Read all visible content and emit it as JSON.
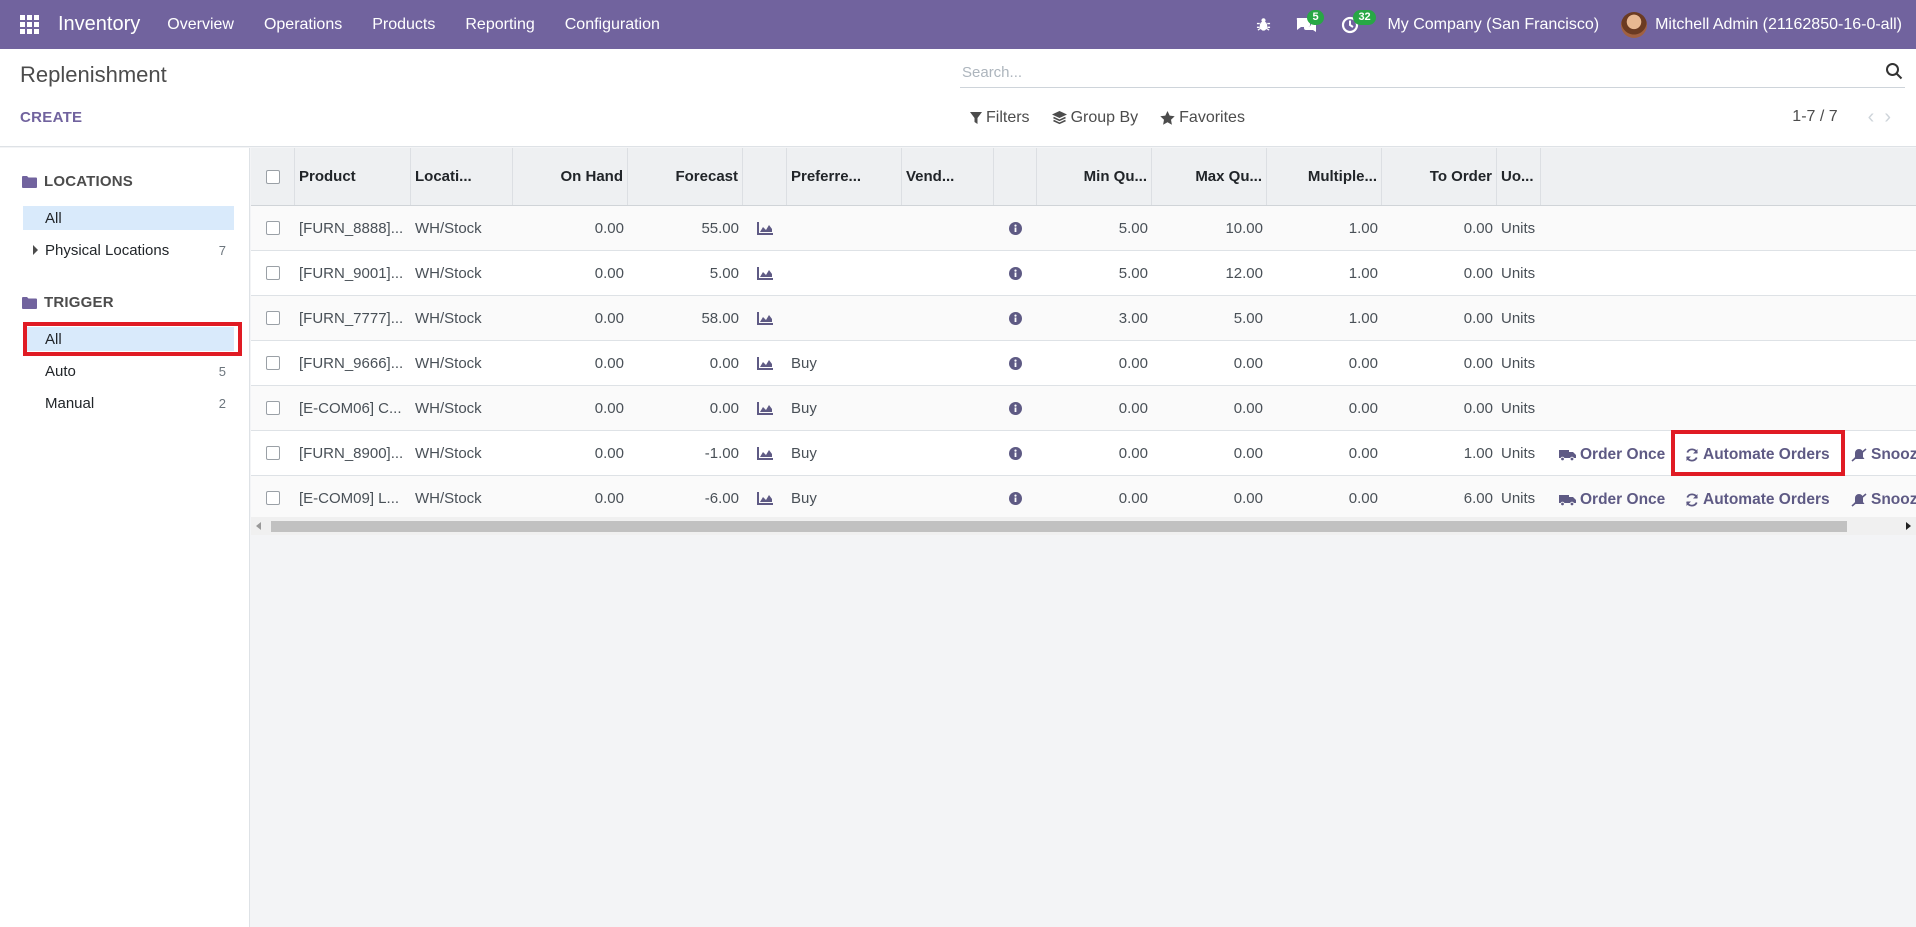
{
  "navbar": {
    "app_name": "Inventory",
    "menu": [
      "Overview",
      "Operations",
      "Products",
      "Reporting",
      "Configuration"
    ],
    "messages_badge": "5",
    "activities_badge": "32",
    "company": "My Company (San Francisco)",
    "user": "Mitchell Admin (21162850-16-0-all)",
    "bg_color": "#71639e"
  },
  "control_panel": {
    "title": "Replenishment",
    "create_label": "CREATE",
    "search_placeholder": "Search...",
    "filters_label": "Filters",
    "group_by_label": "Group By",
    "favorites_label": "Favorites",
    "pager": "1-7 / 7"
  },
  "search_panel": {
    "locations_header": "LOCATIONS",
    "locations_all": "All",
    "physical_locations": "Physical Locations",
    "physical_locations_count": "7",
    "trigger_header": "TRIGGER",
    "trigger_all": "All",
    "trigger_auto": "Auto",
    "trigger_auto_count": "5",
    "trigger_manual": "Manual",
    "trigger_manual_count": "2"
  },
  "table": {
    "headers": {
      "product": "Product",
      "location": "Locati...",
      "on_hand": "On Hand",
      "forecast": "Forecast",
      "preferred_route": "Preferre...",
      "vendor": "Vend...",
      "min_qty": "Min Qu...",
      "max_qty": "Max Qu...",
      "multiple": "Multiple...",
      "to_order": "To Order",
      "uom": "Uo..."
    },
    "rows": [
      {
        "product": "[FURN_8888]...",
        "location": "WH/Stock",
        "on_hand": "0.00",
        "forecast": "55.00",
        "route": "",
        "min": "5.00",
        "max": "10.00",
        "multiple": "1.00",
        "to_order": "0.00",
        "uom": "Units",
        "order_once": "",
        "automate": "",
        "snooze": ""
      },
      {
        "product": "[FURN_9001]...",
        "location": "WH/Stock",
        "on_hand": "0.00",
        "forecast": "5.00",
        "route": "",
        "min": "5.00",
        "max": "12.00",
        "multiple": "1.00",
        "to_order": "0.00",
        "uom": "Units",
        "order_once": "",
        "automate": "",
        "snooze": ""
      },
      {
        "product": "[FURN_7777]...",
        "location": "WH/Stock",
        "on_hand": "0.00",
        "forecast": "58.00",
        "route": "",
        "min": "3.00",
        "max": "5.00",
        "multiple": "1.00",
        "to_order": "0.00",
        "uom": "Units",
        "order_once": "",
        "automate": "",
        "snooze": ""
      },
      {
        "product": "[FURN_9666]...",
        "location": "WH/Stock",
        "on_hand": "0.00",
        "forecast": "0.00",
        "route": "Buy",
        "min": "0.00",
        "max": "0.00",
        "multiple": "0.00",
        "to_order": "0.00",
        "uom": "Units",
        "order_once": "",
        "automate": "",
        "snooze": ""
      },
      {
        "product": "[E-COM06] C...",
        "location": "WH/Stock",
        "on_hand": "0.00",
        "forecast": "0.00",
        "route": "Buy",
        "min": "0.00",
        "max": "0.00",
        "multiple": "0.00",
        "to_order": "0.00",
        "uom": "Units",
        "order_once": "",
        "automate": "",
        "snooze": ""
      },
      {
        "product": "[FURN_8900]...",
        "location": "WH/Stock",
        "on_hand": "0.00",
        "forecast": "-1.00",
        "route": "Buy",
        "min": "0.00",
        "max": "0.00",
        "multiple": "0.00",
        "to_order": "1.00",
        "uom": "Units",
        "order_once": "Order Once",
        "automate": "Automate Orders",
        "snooze": "Snooz"
      },
      {
        "product": "[E-COM09] L...",
        "location": "WH/Stock",
        "on_hand": "0.00",
        "forecast": "-6.00",
        "route": "Buy",
        "min": "0.00",
        "max": "0.00",
        "multiple": "0.00",
        "to_order": "6.00",
        "uom": "Units",
        "order_once": "Order Once",
        "automate": "Automate Orders",
        "snooze": "Snooz"
      }
    ]
  }
}
